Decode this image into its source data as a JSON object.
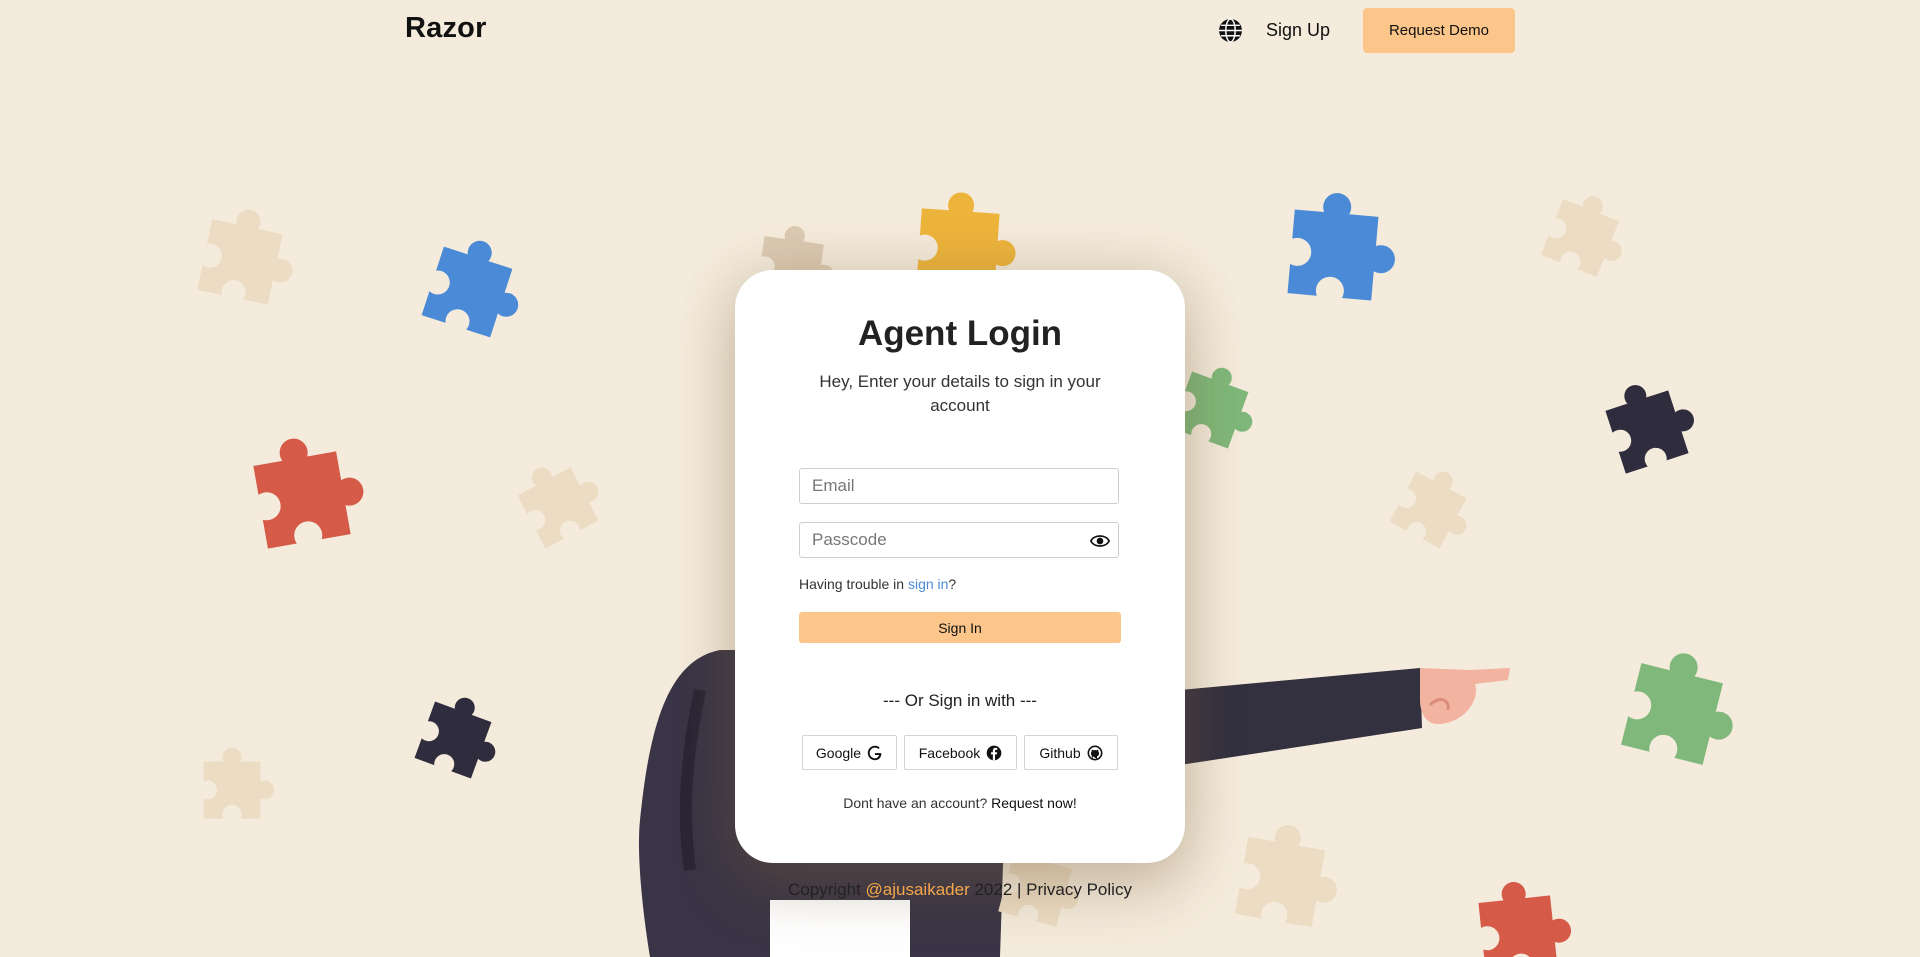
{
  "header": {
    "logo": "Razor",
    "language_icon": "globe-icon",
    "signup_label": "Sign Up",
    "demo_label": "Request Demo"
  },
  "login": {
    "title": "Agent Login",
    "subtitle": "Hey, Enter your details to sign in your account",
    "email_placeholder": "Email",
    "email_value": "",
    "passcode_placeholder": "Passcode",
    "passcode_value": "",
    "toggle_icon": "eye-icon",
    "trouble_prefix": "Having trouble in ",
    "trouble_link": "sign in",
    "trouble_suffix": "?",
    "signin_label": "Sign In",
    "or_text": "--- Or Sign in with ---",
    "social": [
      {
        "label": "Google",
        "icon": "google-icon"
      },
      {
        "label": "Facebook",
        "icon": "facebook-icon"
      },
      {
        "label": "Github",
        "icon": "github-icon"
      }
    ],
    "no_account_text": "Dont have an account? ",
    "request_link": "Request now!"
  },
  "footer": {
    "prefix": "Copyright ",
    "handle": "@ajusaikader",
    "suffix": " 2022 | Privacy Policy"
  },
  "colors": {
    "background": "#f5ebdc",
    "accent": "#fcc68a",
    "link": "#4a8ad6",
    "handle": "#f5a64a",
    "puzzle_blue": "#4a8ad6",
    "puzzle_red": "#d55a48",
    "puzzle_green": "#7fb87a",
    "puzzle_dark": "#2f2c3d",
    "puzzle_yellow": "#edb43c",
    "puzzle_beige": "#ecdcc4"
  }
}
